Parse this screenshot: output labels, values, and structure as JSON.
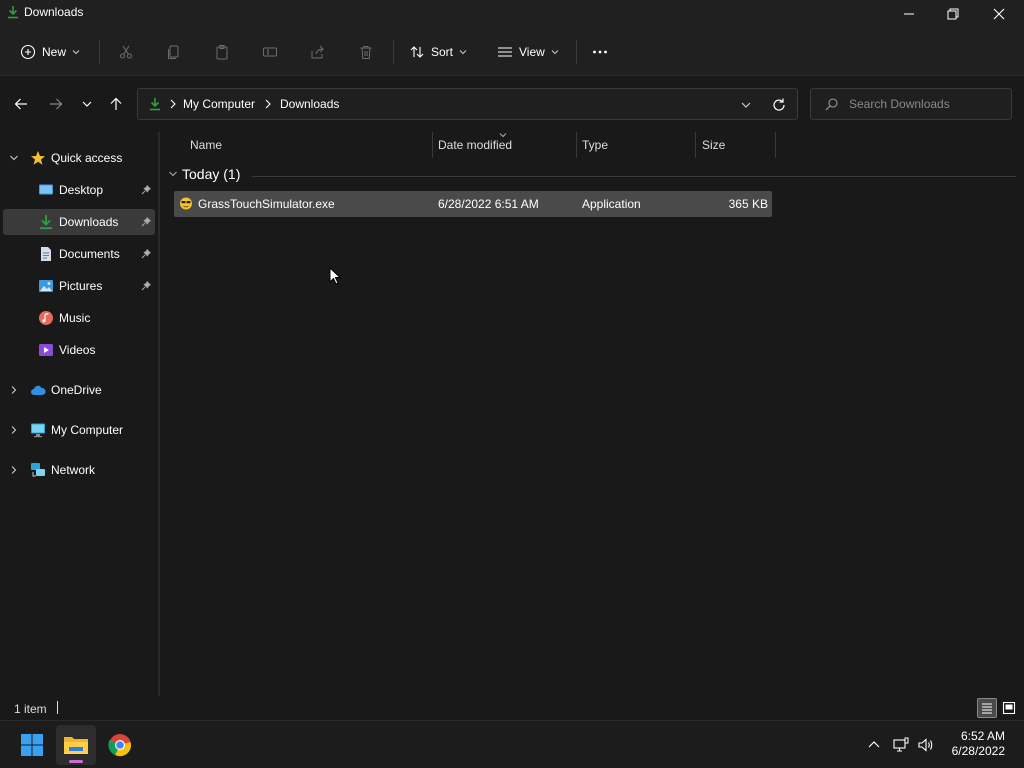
{
  "window": {
    "title": "Downloads"
  },
  "toolbar": {
    "new_label": "New",
    "sort_label": "Sort",
    "view_label": "View"
  },
  "address": {
    "crumbs": [
      "My Computer",
      "Downloads"
    ]
  },
  "search": {
    "placeholder": "Search Downloads"
  },
  "sidebar": {
    "quick_access": "Quick access",
    "items": [
      {
        "label": "Desktop",
        "icon": "desktop-icon",
        "pinned": true
      },
      {
        "label": "Downloads",
        "icon": "downloads-icon",
        "pinned": true,
        "selected": true
      },
      {
        "label": "Documents",
        "icon": "documents-icon",
        "pinned": true
      },
      {
        "label": "Pictures",
        "icon": "pictures-icon",
        "pinned": true
      },
      {
        "label": "Music",
        "icon": "music-icon",
        "pinned": false
      },
      {
        "label": "Videos",
        "icon": "videos-icon",
        "pinned": false
      }
    ],
    "onedrive": "OneDrive",
    "my_computer": "My Computer",
    "network": "Network"
  },
  "columns": {
    "name": "Name",
    "date": "Date modified",
    "type": "Type",
    "size": "Size"
  },
  "group": {
    "label": "Today (1)"
  },
  "files": [
    {
      "name": "GrassTouchSimulator.exe",
      "date": "6/28/2022 6:51 AM",
      "type": "Application",
      "size": "365 KB"
    }
  ],
  "status": {
    "count": "1 item"
  },
  "clock": {
    "time": "6:52 AM",
    "date": "6/28/2022"
  },
  "colors": {
    "accent_green": "#2ea043",
    "selection": "#4a4a4a",
    "background": "#191919"
  }
}
